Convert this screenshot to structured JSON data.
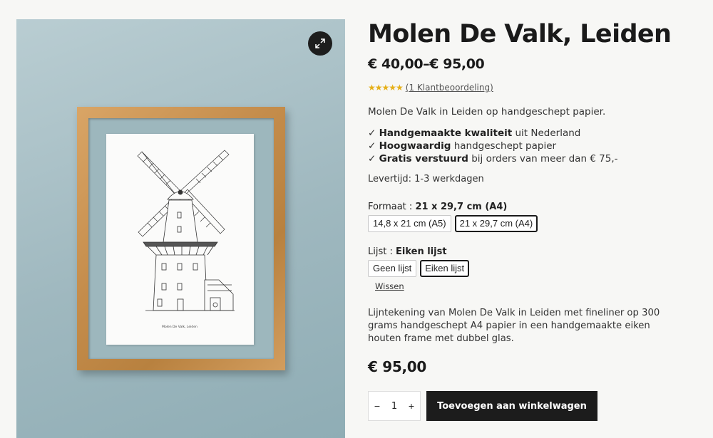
{
  "product": {
    "title": "Molen De Valk, Leiden",
    "price_range": "€ 40,00–€ 95,00",
    "rating": {
      "stars": "★★★★★",
      "review_link": "(1 Klantbeoordeling)",
      "value": 5,
      "max": 5
    },
    "intro": "Molen De Valk in Leiden op handgeschept papier.",
    "usps": [
      {
        "check": "✓",
        "bold": "Handgemaakte kwaliteit",
        "rest": " uit Nederland"
      },
      {
        "check": "✓",
        "bold": "Hoogwaardig",
        "rest": " handgeschept papier"
      },
      {
        "check": "✓",
        "bold": "Gratis verstuurd",
        "rest": " bij orders van meer dan € 75,-"
      }
    ],
    "lead_time": "Levertijd: 1-3 werkdagen",
    "attributes": {
      "format": {
        "label": "Formaat",
        "separator": " : ",
        "selected": "21 x 29,7 cm (A4)",
        "options": [
          "14,8 x 21 cm (A5)",
          "21 x 29,7 cm (A4)"
        ]
      },
      "frame": {
        "label": "Lijst",
        "separator": " : ",
        "selected": "Eiken lijst",
        "options": [
          "Geen lijst",
          "Eiken lijst"
        ]
      },
      "reset_label": "Wissen"
    },
    "description": "Lijntekening van Molen De Valk in Leiden met fineliner op 300 grams handgeschept A4 papier in een handgemaakte eiken houten frame met dubbel glas.",
    "price": "€ 95,00",
    "quantity": {
      "minus": "−",
      "value": "1",
      "plus": "+"
    },
    "add_to_cart": "Toevoegen aan winkelwagen"
  },
  "image": {
    "zoom_icon": "expand-icon",
    "paper_caption": "Molen De Valk, Leiden",
    "colors": {
      "background": "#a7bfc5",
      "frame": "#c8914f",
      "paper": "#fbfbfa"
    }
  },
  "colors": {
    "text": "#1a1a1a",
    "star": "#e6b019",
    "button": "#1c1c1c"
  }
}
